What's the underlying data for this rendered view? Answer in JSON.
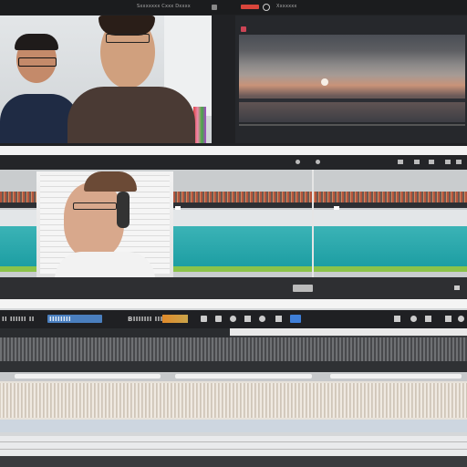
{
  "window": {
    "title_left": "Sxxxxxxx Cxxx Dxxxx",
    "title_right": "Xxxxxxx"
  },
  "top": {
    "preview_a_label": "webcam-preview",
    "preview_b_label": "sunset-preview"
  },
  "middle": {
    "clip_label": "headset-clip"
  },
  "bottom": {
    "toolbar_left": "II IIIIII II",
    "toolbar_mid": "BIIIIIII IIIII",
    "toolbar_badge": "IIIIIIII",
    "zoom_label": "IIII"
  },
  "colors": {
    "accent_red": "#d9453b",
    "accent_blue": "#3f7fd8",
    "accent_teal": "#2aa9ad",
    "accent_orange": "#e08a2a",
    "accent_green": "#8bc34a"
  }
}
